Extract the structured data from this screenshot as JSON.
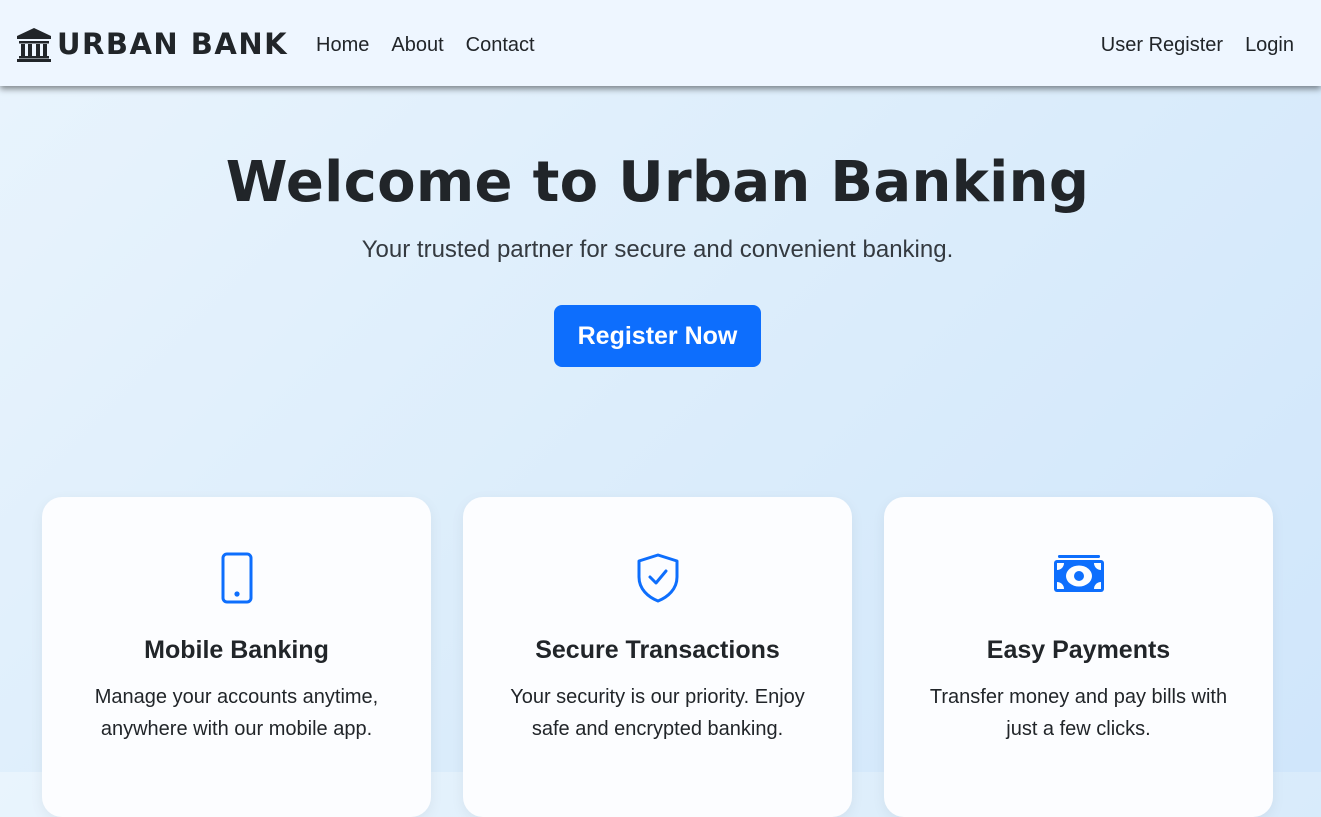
{
  "brand": {
    "name": "URBAN BANK",
    "icon": "bank-icon"
  },
  "nav": {
    "left": [
      "Home",
      "About",
      "Contact"
    ],
    "right": [
      "User Register",
      "Login"
    ]
  },
  "hero": {
    "title": "Welcome to Urban Banking",
    "subtitle": "Your trusted partner for secure and convenient banking.",
    "cta_label": "Register Now"
  },
  "features": [
    {
      "icon": "mobile-phone-icon",
      "title": "Mobile Banking",
      "text": "Manage your accounts anytime, anywhere with our mobile app."
    },
    {
      "icon": "shield-check-icon",
      "title": "Secure Transactions",
      "text": "Your security is our priority. Enjoy safe and encrypted banking."
    },
    {
      "icon": "cash-icon",
      "title": "Easy Payments",
      "text": "Transfer money and pay bills with just a few clicks."
    }
  ],
  "colors": {
    "accent": "#0d6efd",
    "text": "#212529",
    "navbar_bg": "#eef6ff"
  }
}
